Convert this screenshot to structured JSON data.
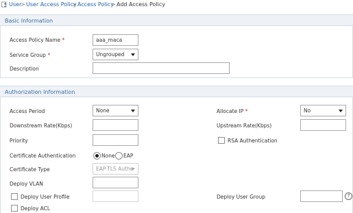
{
  "breadcrumb": {
    "items": [
      "User",
      "User Access Policy",
      "Access Policy",
      "Add Access Policy"
    ],
    "separator": ">"
  },
  "basic": {
    "title": "Basic Information",
    "policy_name_label": "Access Policy Name",
    "policy_name_value": "aaa_maca",
    "service_group_label": "Service Group",
    "service_group_value": "Ungrouped",
    "description_label": "Description",
    "description_value": "",
    "required_mark": "*"
  },
  "auth": {
    "title": "Authorization Information",
    "access_period_label": "Access Period",
    "access_period_value": "None",
    "allocate_ip_label": "Allocate IP",
    "allocate_ip_value": "No",
    "downstream_label": "Downstream Rate(Kbps)",
    "upstream_label": "Upstream Rate(Kbps)",
    "priority_label": "Priority",
    "rsa_label": "RSA Authentication",
    "cert_auth_label": "Certificate Authentication",
    "cert_auth_none": "None",
    "cert_auth_eap": "EAP",
    "cert_type_label": "Certificate Type",
    "cert_type_value": "EAP-TLS Authe",
    "deploy_vlan_label": "Deploy VLAN",
    "deploy_user_profile_label": "Deploy User Profile",
    "deploy_user_group_label": "Deploy User Group",
    "deploy_acl_label": "Deploy ACL",
    "help_glyph": "?"
  },
  "colors": {
    "link": "#1f5fa8",
    "section_title": "#3c6ea5",
    "section_bg": "#eef2f7",
    "required": "#d22222"
  }
}
